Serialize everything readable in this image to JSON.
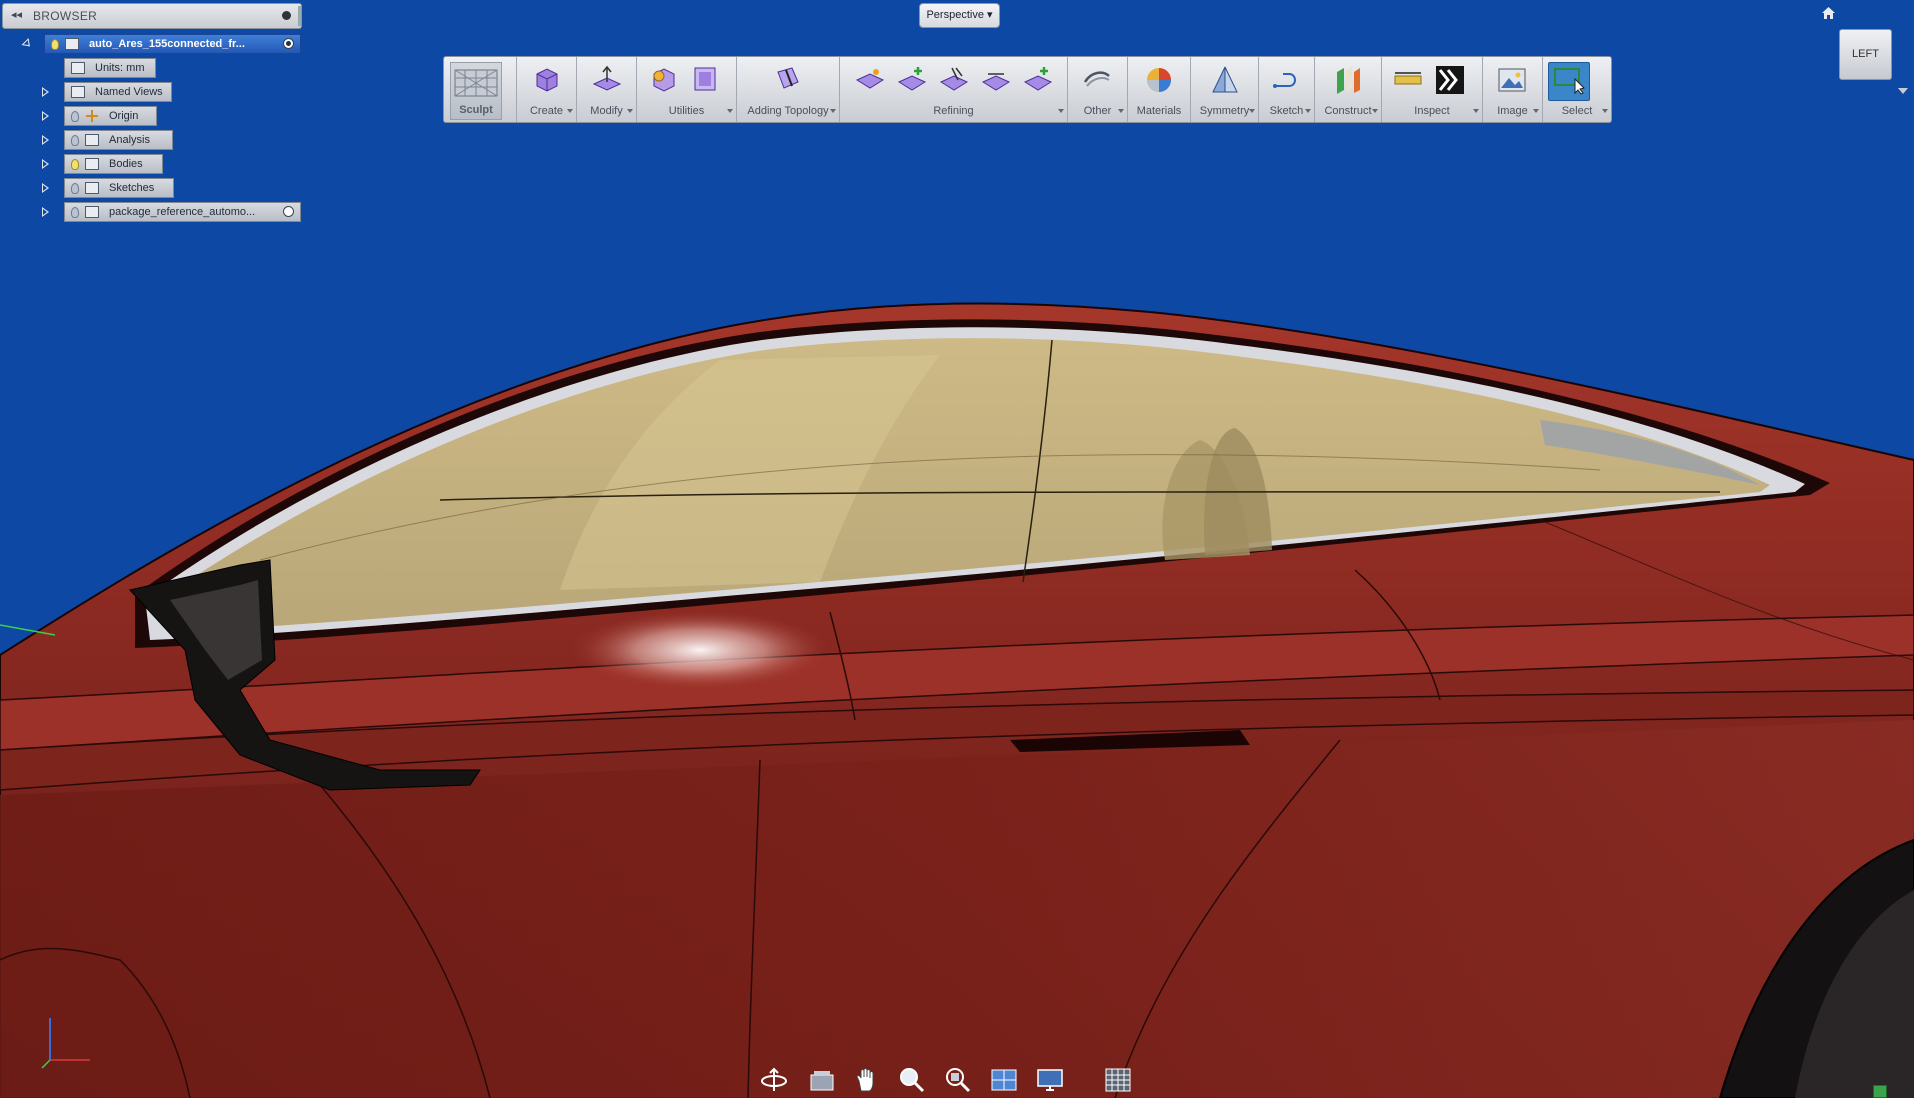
{
  "browser": {
    "title": "BROWSER",
    "items": [
      {
        "label": "auto_Ares_155connected_fr...",
        "state": "root"
      },
      {
        "label": "Units: mm"
      },
      {
        "label": "Named Views"
      },
      {
        "label": "Origin"
      },
      {
        "label": "Analysis"
      },
      {
        "label": "Bodies"
      },
      {
        "label": "Sketches"
      },
      {
        "label": "package_reference_automo..."
      }
    ]
  },
  "view": {
    "projection": "Perspective",
    "viewcube_face": "LEFT"
  },
  "toolbar": {
    "groups": [
      {
        "label": "Sculpt"
      },
      {
        "label": "Create"
      },
      {
        "label": "Modify"
      },
      {
        "label": "Utilities"
      },
      {
        "label": "Adding Topology"
      },
      {
        "label": "Refining"
      },
      {
        "label": "Other"
      },
      {
        "label": "Materials"
      },
      {
        "label": "Symmetry"
      },
      {
        "label": "Sketch"
      },
      {
        "label": "Construct"
      },
      {
        "label": "Inspect"
      },
      {
        "label": "Image"
      },
      {
        "label": "Select"
      }
    ]
  },
  "colors": {
    "background": "#0d48a4",
    "body_paint": "#8c2a22",
    "glass_tint": "#c4b07c",
    "toolbar": "#dde0e5",
    "active_tool": "#3a86c8"
  },
  "icons": {
    "nav": [
      "orbit-icon",
      "look-at-icon",
      "pan-icon",
      "zoom-icon",
      "zoom-window-icon",
      "display-settings-icon",
      "visual-style-icon",
      "grid-icon"
    ]
  }
}
